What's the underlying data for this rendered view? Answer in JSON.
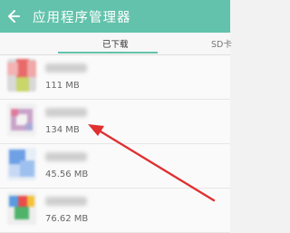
{
  "header": {
    "title": "应用程序管理器",
    "back_icon": "back-arrow-icon"
  },
  "tabs": [
    {
      "label": "已下载",
      "selected": true
    },
    {
      "label": "SD卡",
      "selected": false
    }
  ],
  "apps": [
    {
      "size": "111 MB"
    },
    {
      "size": "134 MB"
    },
    {
      "size": "45.56 MB"
    },
    {
      "size": "76.62 MB"
    }
  ],
  "annotation": {
    "type": "red-arrow",
    "color": "#e03030",
    "target": "134 MB"
  },
  "colors": {
    "accent": "#62c2ab",
    "annotation_red": "#e03030"
  }
}
